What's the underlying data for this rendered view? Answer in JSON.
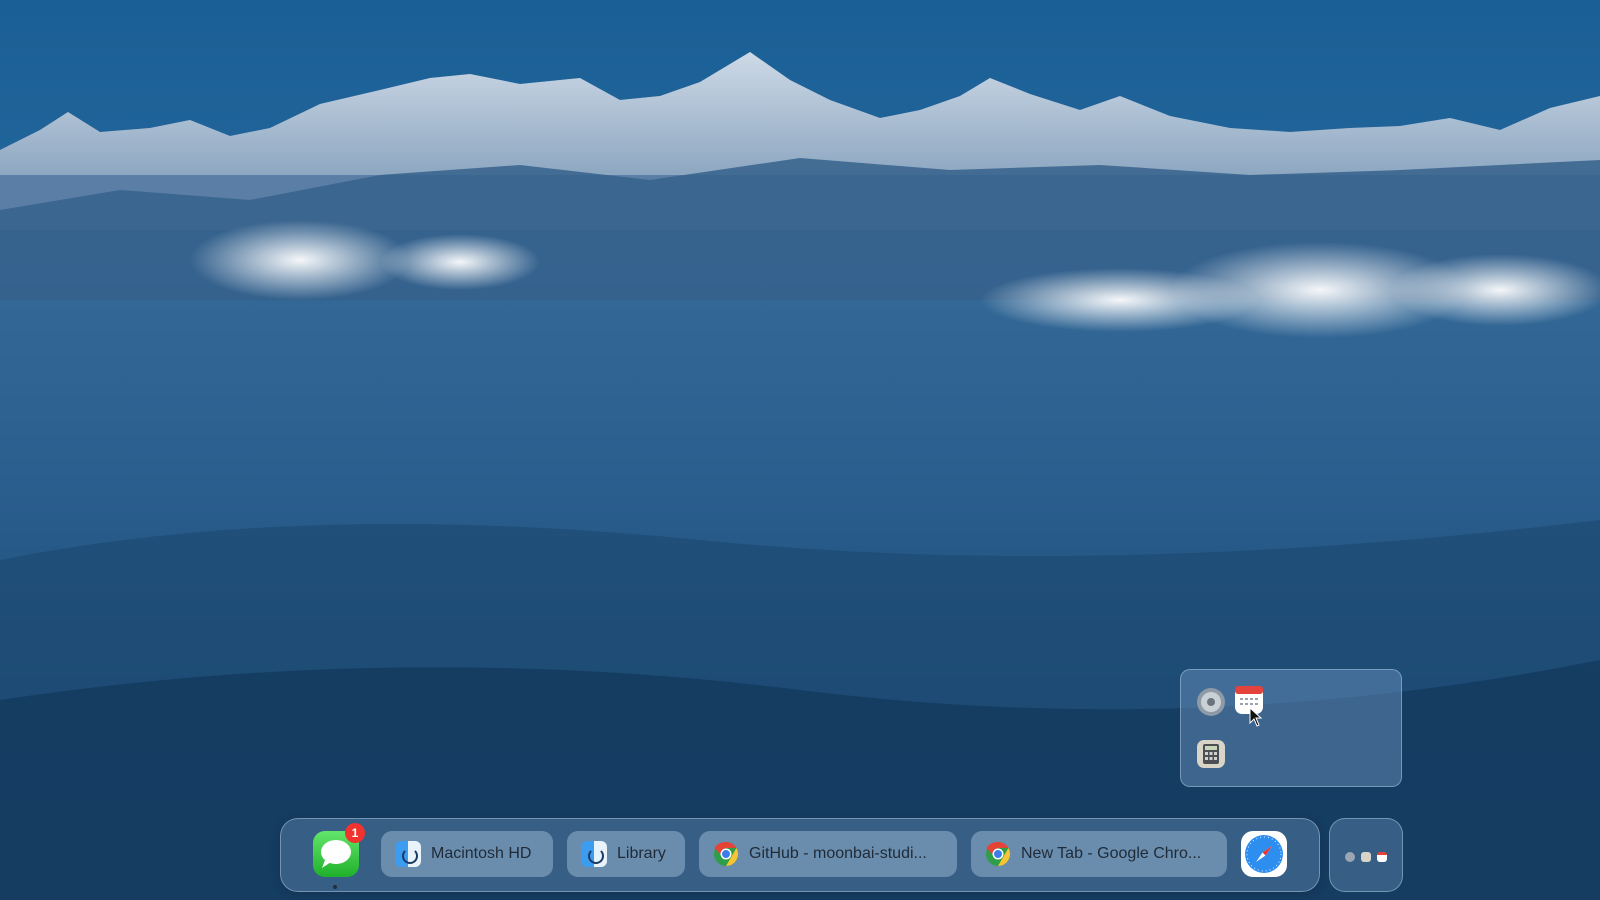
{
  "dock": {
    "apps": [
      {
        "name": "Messages",
        "icon": "messages-icon",
        "badge": "1",
        "running": true
      },
      {
        "name": "Safari",
        "icon": "safari-icon"
      }
    ],
    "windows": [
      {
        "title": "Macintosh HD",
        "icon": "finder-icon"
      },
      {
        "title": "Library",
        "icon": "finder-icon"
      },
      {
        "title": "GitHub - moonbai-studi...",
        "icon": "chrome-icon"
      },
      {
        "title": "New Tab - Google Chro...",
        "icon": "chrome-icon"
      }
    ],
    "stack_preview_icons": [
      "system-settings-icon",
      "calculator-icon",
      "calendar-icon"
    ]
  },
  "stack_popover": {
    "items": [
      {
        "app": "System Settings",
        "icon": "system-settings-icon"
      },
      {
        "app": "Calendar",
        "icon": "calendar-icon"
      },
      {
        "app": "Calculator",
        "icon": "calculator-icon"
      }
    ]
  },
  "colors": {
    "sky_top": "#1a5f95",
    "sky_horizon": "#3c7cb0",
    "valley_dark": "#143a5e",
    "badge_red": "#f0332e",
    "messages_green": "#30c33c"
  }
}
